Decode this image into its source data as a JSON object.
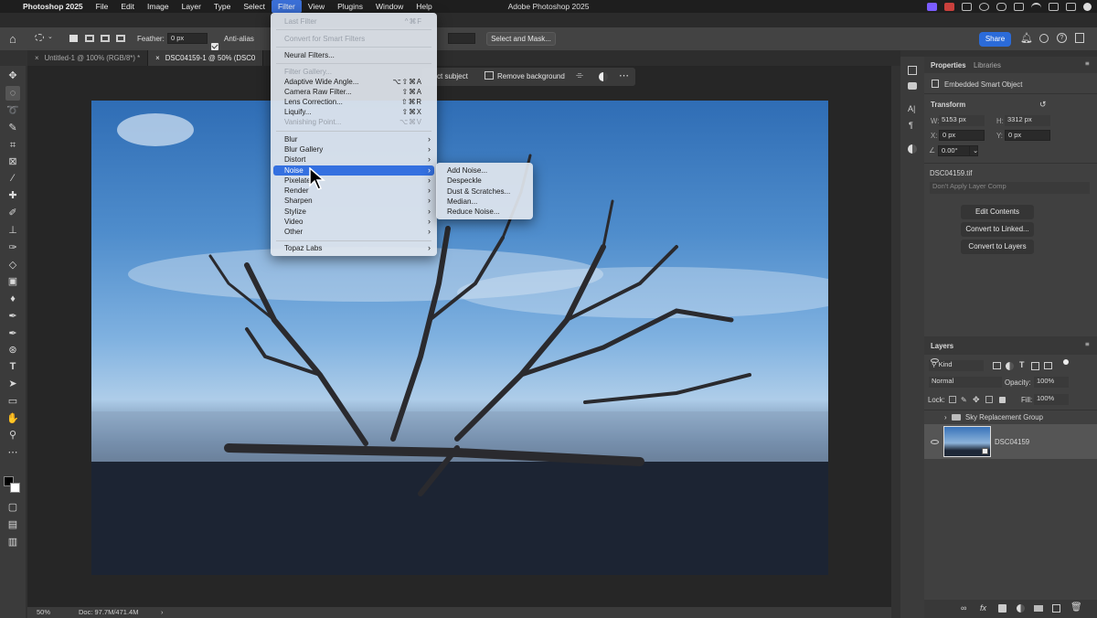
{
  "menubar": {
    "apple": "",
    "app_name": "Photoshop 2025",
    "items": [
      "File",
      "Edit",
      "Image",
      "Layer",
      "Type",
      "Select",
      "Filter",
      "View",
      "Plugins",
      "Window",
      "Help"
    ],
    "active": "Filter",
    "window_title": "Adobe Photoshop 2025"
  },
  "options_bar": {
    "feather_label": "Feather:",
    "feather_value": "0 px",
    "anti_alias_label": "Anti-alias",
    "select_and_mask": "Select and Mask...",
    "share": "Share"
  },
  "doc_tabs": [
    {
      "label": "Untitled-1 @ 100% (RGB/8*) *",
      "active": false
    },
    {
      "label": "DSC04159-1 @ 50% (DSC0",
      "active": true
    }
  ],
  "context_bar": {
    "select_subject": "ct subject",
    "remove_background": "Remove background"
  },
  "status": {
    "zoom": "50%",
    "doc": "Doc: 97.7M/471.4M"
  },
  "filter_menu": {
    "last_filter": {
      "label": "Last Filter",
      "shortcut": "^⌘F"
    },
    "convert_smart": "Convert for Smart Filters",
    "neural": "Neural Filters...",
    "filter_gallery": "Filter Gallery...",
    "adaptive": {
      "label": "Adaptive Wide Angle...",
      "shortcut": "⌥⇧⌘A"
    },
    "camera_raw": {
      "label": "Camera Raw Filter...",
      "shortcut": "⇧⌘A"
    },
    "lens_correction": {
      "label": "Lens Correction...",
      "shortcut": "⇧⌘R"
    },
    "liquify": {
      "label": "Liquify...",
      "shortcut": "⇧⌘X"
    },
    "vanishing": {
      "label": "Vanishing Point...",
      "shortcut": "⌥⌘V"
    },
    "submenus": [
      "Blur",
      "Blur Gallery",
      "Distort",
      "Noise",
      "Pixelate",
      "Render",
      "Sharpen",
      "Stylize",
      "Video",
      "Other"
    ],
    "highlighted": "Noise",
    "topaz": "Topaz Labs"
  },
  "noise_submenu": [
    "Add Noise...",
    "Despeckle",
    "Dust & Scratches...",
    "Median...",
    "Reduce Noise..."
  ],
  "properties": {
    "tab_properties": "Properties",
    "tab_libraries": "Libraries",
    "object_type": "Embedded Smart Object",
    "transform": "Transform",
    "w_label": "W:",
    "w_value": "5153 px",
    "h_label": "H:",
    "h_value": "3312 px",
    "x_label": "X:",
    "x_value": "0 px",
    "y_label": "Y:",
    "y_value": "0 px",
    "angle_value": "0.00°",
    "filename": "DSC04159.tif",
    "layer_comp": "Don't Apply Layer Comp",
    "edit_contents": "Edit Contents",
    "convert_linked": "Convert to Linked...",
    "convert_layers": "Convert to Layers"
  },
  "layers": {
    "title": "Layers",
    "kind": "Kind",
    "blend": "Normal",
    "opacity_label": "Opacity:",
    "opacity_value": "100%",
    "lock_label": "Lock:",
    "fill_label": "Fill:",
    "fill_value": "100%",
    "items": [
      "Sky Replacement Group",
      "DSC04159"
    ]
  },
  "colors": {
    "accent": "#3470e0",
    "share": "#2b6bd9"
  }
}
